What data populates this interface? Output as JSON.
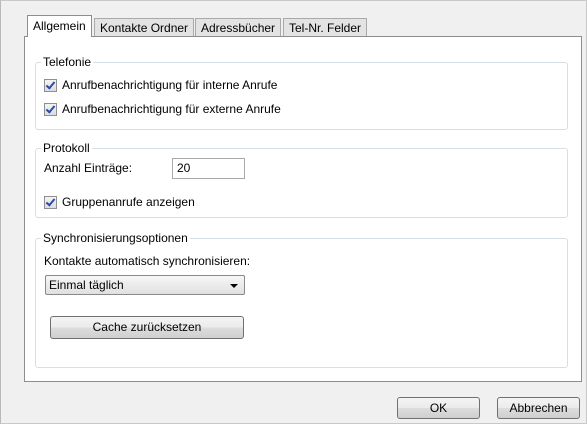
{
  "tabs": [
    {
      "label": "Allgemein",
      "active": true
    },
    {
      "label": "Kontakte Ordner",
      "active": false
    },
    {
      "label": "Adressbücher",
      "active": false
    },
    {
      "label": "Tel-Nr. Felder",
      "active": false
    }
  ],
  "telefonie": {
    "legend": "Telefonie",
    "internal_calls_label": "Anrufbenachrichtigung für interne Anrufe",
    "internal_calls_checked": true,
    "external_calls_label": "Anrufbenachrichtigung für externe Anrufe",
    "external_calls_checked": true
  },
  "protokoll": {
    "legend": "Protokoll",
    "entries_label": "Anzahl Einträge:",
    "entries_value": "20",
    "group_calls_label": "Gruppenanrufe anzeigen",
    "group_calls_checked": true
  },
  "sync": {
    "legend": "Synchronisierungsoptionen",
    "auto_sync_label": "Kontakte automatisch synchronisieren:",
    "auto_sync_selected": "Einmal täglich",
    "reset_cache_label": "Cache zurücksetzen"
  },
  "dialog": {
    "ok_label": "OK",
    "cancel_label": "Abbrechen"
  }
}
